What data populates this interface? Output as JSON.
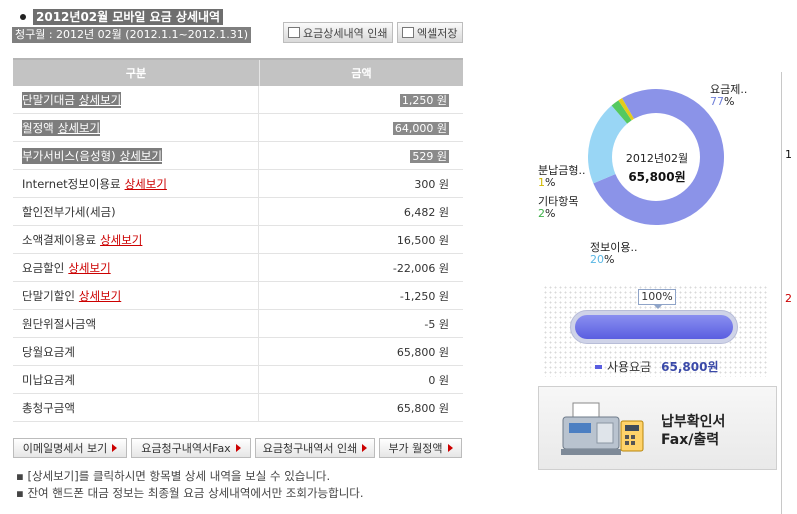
{
  "header": {
    "title": "2012년02월 모바일 요금 상세내역",
    "billing_period": "청구월 : 2012년 02월 (2012.1.1~2012.1.31)",
    "print_button": "요금상세내역 인쇄",
    "excel_button": "엑셀저장"
  },
  "table": {
    "col_item": "구분",
    "col_amount": "금액",
    "detail_link": "상세보기",
    "rows": [
      {
        "label": "단말기대금",
        "link": "상세보기",
        "amount": "1,250 원"
      },
      {
        "label": "월정액",
        "link": "상세보기",
        "amount": "64,000 원"
      },
      {
        "label": "부가서비스(음성형)",
        "link": "상세보기",
        "amount": "529 원"
      },
      {
        "label": "Internet정보이용료",
        "link": "상세보기",
        "amount": "300 원"
      },
      {
        "label": "할인전부가세(세금)",
        "link": "",
        "amount": "6,482 원"
      },
      {
        "label": "소액결제이용료",
        "link": "상세보기",
        "amount": "16,500 원"
      },
      {
        "label": "요금할인",
        "link": "상세보기",
        "amount": "-22,006 원"
      },
      {
        "label": "단말기할인",
        "link": "상세보기",
        "amount": "-1,250 원"
      },
      {
        "label": "원단위절사금액",
        "link": "",
        "amount": "-5 원"
      },
      {
        "label": "당월요금계",
        "link": "",
        "amount": "65,800 원"
      },
      {
        "label": "미납요금계",
        "link": "",
        "amount": "0 원"
      },
      {
        "label": "총청구금액",
        "link": "",
        "amount": "65,800 원"
      }
    ]
  },
  "bottom_buttons": {
    "email_view": "이메일명세서 보기",
    "fax_bill": "요금청구내역서Fax",
    "print_bill": "요금청구내역서 인쇄",
    "vat_flat": "부가 월정액"
  },
  "notes": [
    "[상세보기]를 클릭하시면 항목별 상세 내역을 보실 수 있습니다.",
    "잔여 핸드폰 대금 정보는 최종월 요금 상세내역에서만 조회가능합니다."
  ],
  "chart_data": {
    "type": "pie",
    "center_month": "2012년02월",
    "center_total": "65,800원",
    "slices": [
      {
        "label": "요금제..",
        "percent_text": "77",
        "value": 77,
        "color": "#8b93e8"
      },
      {
        "label": "정보이용..",
        "percent_text": "20",
        "value": 20,
        "color": "#99d6f5"
      },
      {
        "label": "기타항목",
        "percent_text": "2",
        "value": 2,
        "color": "#55c95f"
      },
      {
        "label": "분납금형..",
        "percent_text": "1",
        "value": 1,
        "color": "#e4cc1a"
      }
    ],
    "percent_sign": "%"
  },
  "usage": {
    "percent_label": "100%",
    "fill_fraction": 1.0,
    "legend_label": "사용요금",
    "legend_value": "65,800원"
  },
  "fax": {
    "line1": "납부확인서",
    "line2": "Fax/출력"
  },
  "edge_fragments": [
    "1",
    "2"
  ]
}
